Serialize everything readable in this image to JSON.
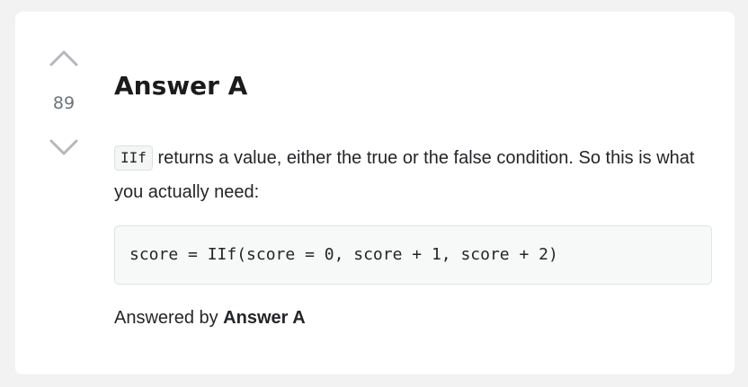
{
  "vote": {
    "count": "89",
    "up_icon": "chevron-up-icon",
    "down_icon": "chevron-down-icon",
    "icon_color": "#b4b8bc"
  },
  "answer": {
    "title": "Answer A",
    "inline_code": "IIf",
    "text_after_code": " returns a value, either the true or the false condition. So this is what you actually need:",
    "code_block": "score = IIf(score = 0, score + 1, score + 2)",
    "answered_by_prefix": "Answered by ",
    "answered_by_name": "Answer A"
  }
}
